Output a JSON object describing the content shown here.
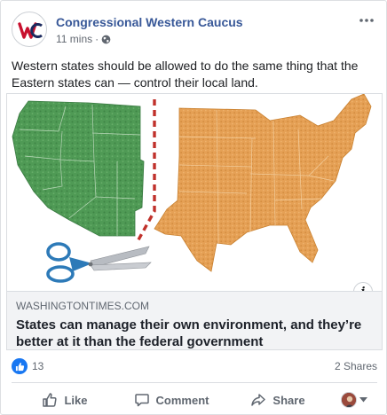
{
  "post": {
    "page_name": "Congressional Western Caucus",
    "timestamp": "11 mins",
    "audience_icon": "globe-icon",
    "more_icon": "more-options-icon",
    "text": "Western states should be allowed to do the same thing that the Eastern states can — control their local land."
  },
  "avatar": {
    "logo_letters": "WC",
    "logo_color": "#c8102e"
  },
  "link": {
    "domain": "WASHINGTONTIMES.COM",
    "title": "States can manage their own environment, and they’re better at it than the federal government",
    "info_label": "i"
  },
  "stats": {
    "likes": "13",
    "shares": "2 Shares"
  },
  "actions": {
    "like": "Like",
    "comment": "Comment",
    "share": "Share"
  },
  "colors": {
    "brand_link": "#385898",
    "like_blue": "#1877f2",
    "west_green": "#4f9a55",
    "east_orange": "#e5a055",
    "cut_line_red": "#c0312b",
    "scissors_blue": "#2d7ab8"
  }
}
